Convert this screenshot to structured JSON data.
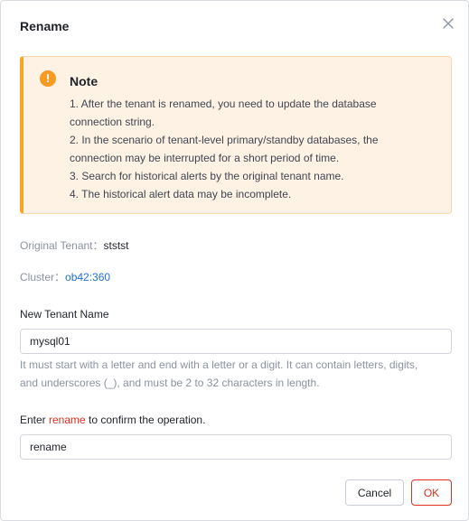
{
  "dialog": {
    "title": "Rename",
    "close_icon": "close-icon"
  },
  "note": {
    "icon": "warning-icon",
    "icon_glyph": "!",
    "title": "Note",
    "lines": [
      "1. After the tenant is renamed, you need to update the database",
      "connection string.",
      "2. In the scenario of tenant-level primary/standby databases, the",
      "connection may be interrupted for a short period of time.",
      "3. Search for historical alerts by the original tenant name.",
      "4. The historical alert data may be incomplete."
    ]
  },
  "info": {
    "original_tenant_label": "Original Tenant：",
    "original_tenant_value": "ststst",
    "cluster_label": "Cluster：",
    "cluster_value": "ob42:360"
  },
  "new_name": {
    "label": "New Tenant Name",
    "value": "mysql01",
    "hint_line1": "It must start with a letter and end with a letter or a digit. It can contain letters, digits,",
    "hint_line2": "and underscores (_), and must be 2 to 32 characters in length."
  },
  "confirm": {
    "label_prefix": "Enter ",
    "label_keyword": "rename",
    "label_suffix": " to confirm the operation.",
    "value": "rename"
  },
  "buttons": {
    "cancel": "Cancel",
    "ok": "OK"
  },
  "colors": {
    "accent_danger": "#e0301e",
    "link": "#1f6fd8",
    "warning": "#f59a23",
    "note_background": "#fdf2e4"
  }
}
